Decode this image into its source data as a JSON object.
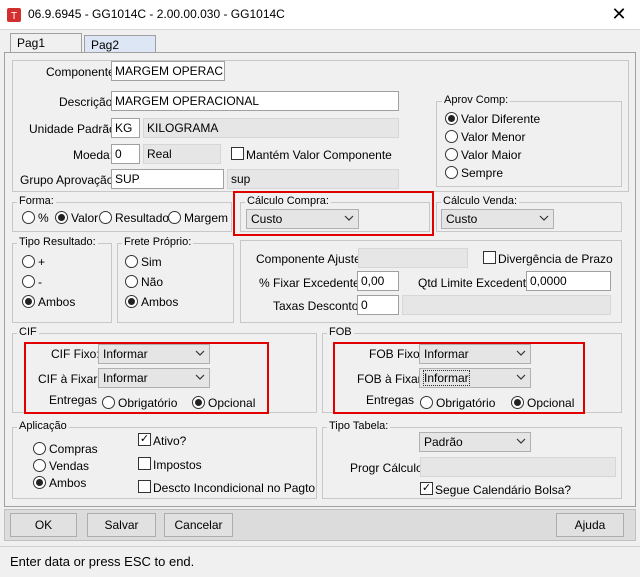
{
  "window": {
    "title": "06.9.6945 - GG1014C - 2.00.00.030 - GG1014C",
    "close": "✕"
  },
  "tabs": [
    "Pag1",
    "Pag2"
  ],
  "top": {
    "componente_label": "Componente:",
    "componente_value": "MARGEM OPERAC",
    "descricao_label": "Descrição:",
    "descricao_value": "MARGEM OPERACIONAL",
    "unidade_label": "Unidade Padrão:",
    "unidade_code": "KG",
    "unidade_desc": "KILOGRAMA",
    "moeda_label": "Moeda:",
    "moeda_value": "0",
    "moeda_desc": "Real",
    "mantem_label": "Mantém Valor Componente",
    "grupo_label": "Grupo Aprovação:",
    "grupo_value": "SUP",
    "grupo_desc": "sup"
  },
  "aprov": {
    "legend": "Aprov Comp:",
    "options": [
      "Valor Diferente",
      "Valor Menor",
      "Valor Maior",
      "Sempre"
    ],
    "selected": 0
  },
  "forma": {
    "legend": "Forma:",
    "options": [
      "%",
      "Valor",
      "Resultado",
      "Margem"
    ],
    "selected": 1
  },
  "calc_compra": {
    "legend": "Cálculo Compra:",
    "value": "Custo"
  },
  "calc_venda": {
    "legend": "Cálculo Venda:",
    "value": "Custo"
  },
  "tipo_resultado": {
    "legend": "Tipo Resultado:",
    "options": [
      "+",
      "-",
      "Ambos"
    ],
    "selected": 2
  },
  "frete": {
    "legend": "Frete Próprio:",
    "options": [
      "Sim",
      "Não",
      "Ambos"
    ],
    "selected": 2
  },
  "ajuste": {
    "componente_label": "Componente Ajuste:",
    "componente_value": "",
    "divergencia_label": "Divergência de Prazo",
    "fixar_label": "% Fixar Excedente:",
    "fixar_value": "0,00",
    "qtd_label": "Qtd Limite Excedente:",
    "qtd_value": "0,0000",
    "taxas_label": "Taxas Desconto:",
    "taxas_value": "0"
  },
  "cif": {
    "legend": "CIF",
    "fixo_label": "CIF Fixo:",
    "fixo_value": "Informar",
    "fixar_label": "CIF à Fixar:",
    "fixar_value": "Informar",
    "entregas_label": "Entregas",
    "options": [
      "Obrigatório",
      "Opcional"
    ],
    "selected": 1
  },
  "fob": {
    "legend": "FOB",
    "fixo_label": "FOB Fixo:",
    "fixo_value": "Informar",
    "fixar_label": "FOB à Fixar:",
    "fixar_value": "Informar",
    "entregas_label": "Entregas",
    "options": [
      "Obrigatório",
      "Opcional"
    ],
    "selected": 1
  },
  "aplicacao": {
    "legend": "Aplicação",
    "options": [
      "Compras",
      "Vendas",
      "Ambos"
    ],
    "selected": 2,
    "checks": [
      {
        "label": "Ativo?",
        "checked": true
      },
      {
        "label": "Impostos",
        "checked": false
      },
      {
        "label": "Descto Incondicional no Pagto",
        "checked": false
      }
    ]
  },
  "tipo_tabela": {
    "legend": "Tipo Tabela:",
    "value": "Padrão",
    "progr_label": "Progr Cálculo:",
    "progr_value": "",
    "segue_label": "Segue Calendário Bolsa?",
    "segue_checked": true
  },
  "buttons": {
    "ok": "OK",
    "salvar": "Salvar",
    "cancelar": "Cancelar",
    "ajuda": "Ajuda"
  },
  "status": "Enter data or press ESC to end.",
  "colors": {
    "highlight": "#e00000",
    "logo": "#d32f2f"
  }
}
